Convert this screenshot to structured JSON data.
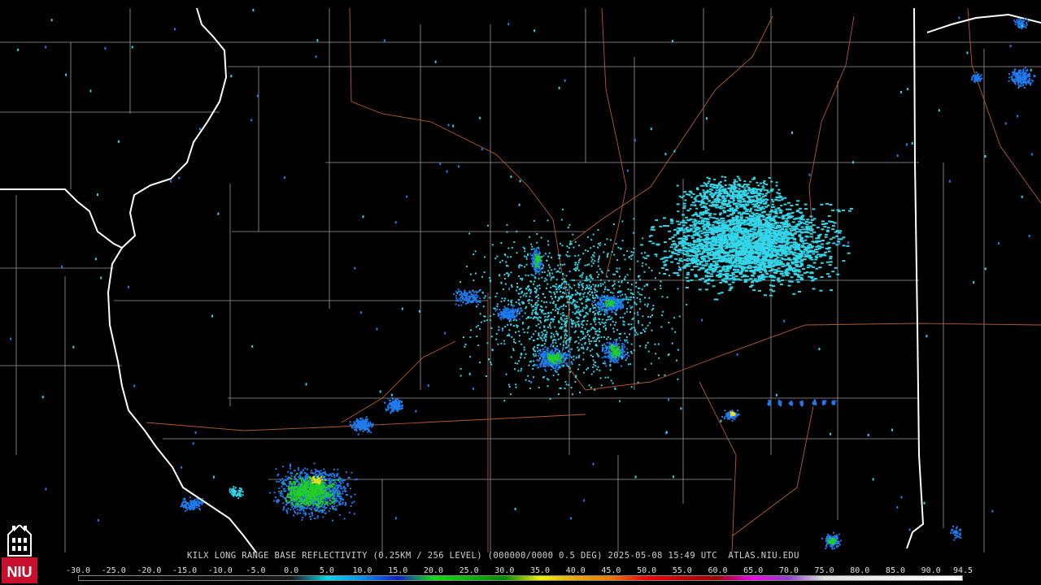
{
  "product": {
    "caption": "KILX LONG RANGE BASE REFLECTIVITY (0.25KM / 256 LEVEL) (000000/0000 0.5 DEG) 2025-05-08 15:49 UTC  ATLAS.NIU.EDU",
    "logo_text": "NIU"
  },
  "colorbar": {
    "labels": [
      "-30.0",
      "-25.0",
      "-20.0",
      "-15.0",
      "-10.0",
      "-5.0",
      "0.0",
      "5.0",
      "10.0",
      "15.0",
      "20.0",
      "25.0",
      "30.0",
      "35.0",
      "40.0",
      "45.0",
      "50.0",
      "55.0",
      "60.0",
      "65.0",
      "70.0",
      "75.0",
      "80.0",
      "85.0",
      "90.0",
      "94.5"
    ],
    "min": -30.0,
    "max": 94.5,
    "stops": [
      {
        "value": -30,
        "color": "#000000"
      },
      {
        "value": 0,
        "color": "#1a1a1a"
      },
      {
        "value": 5,
        "color": "#00d8e8"
      },
      {
        "value": 10,
        "color": "#0090f0"
      },
      {
        "value": 15,
        "color": "#1020c8"
      },
      {
        "value": 20,
        "color": "#10e010"
      },
      {
        "value": 30,
        "color": "#008c00"
      },
      {
        "value": 35,
        "color": "#f0f000"
      },
      {
        "value": 40,
        "color": "#e8a800"
      },
      {
        "value": 45,
        "color": "#f07800"
      },
      {
        "value": 50,
        "color": "#f00000"
      },
      {
        "value": 55,
        "color": "#c80000"
      },
      {
        "value": 60,
        "color": "#a00000"
      },
      {
        "value": 65,
        "color": "#f000f0"
      },
      {
        "value": 70,
        "color": "#9040c8"
      },
      {
        "value": 75,
        "color": "#e0e0e0"
      },
      {
        "value": 94.5,
        "color": "#ffffff"
      }
    ]
  },
  "colors": {
    "state_border": "#ffffff",
    "county_line": "#a0a0a0",
    "highway": "#b85a2c",
    "echo_light": "#33d6e8",
    "echo_mid": "#1e7cf0",
    "echo_strong": "#22d022",
    "echo_core": "#e8e020"
  }
}
